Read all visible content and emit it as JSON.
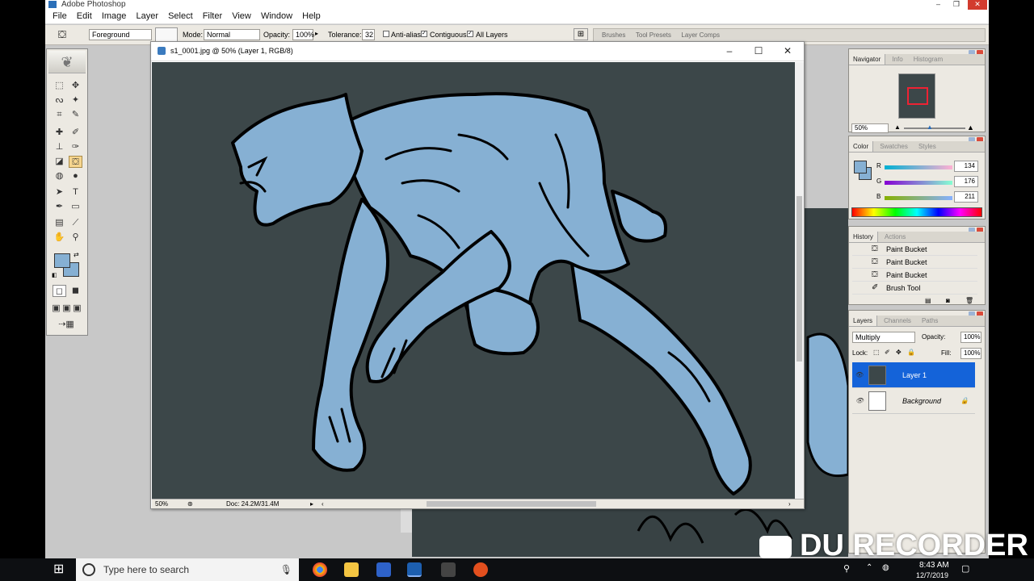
{
  "app": {
    "title": "Adobe Photoshop"
  },
  "menu": [
    "File",
    "Edit",
    "Image",
    "Layer",
    "Select",
    "Filter",
    "View",
    "Window",
    "Help"
  ],
  "options": {
    "fill_source": "Foreground",
    "mode_label": "Mode:",
    "mode_value": "Normal",
    "opacity_label": "Opacity:",
    "opacity_value": "100%",
    "tolerance_label": "Tolerance:",
    "tolerance_value": "32",
    "anti_alias": "Anti-alias",
    "contiguous": "Contiguous",
    "all_layers": "All Layers",
    "wells": [
      "Brushes",
      "Tool Presets",
      "Layer Comps"
    ]
  },
  "document": {
    "title": "s1_0001.jpg @ 50% (Layer 1, RGB/8)",
    "zoom": "50%",
    "doc_size": "Doc: 24.2M/31.4M"
  },
  "navigator": {
    "tabs": [
      "Navigator",
      "Info",
      "Histogram"
    ],
    "zoom": "50%"
  },
  "color": {
    "tabs": [
      "Color",
      "Swatches",
      "Styles"
    ],
    "r_label": "R",
    "g_label": "G",
    "b_label": "B",
    "r": "134",
    "g": "176",
    "b": "211",
    "fg_hex": "#86b0d3"
  },
  "history": {
    "tabs": [
      "History",
      "Actions"
    ],
    "items": [
      "Paint Bucket",
      "Paint Bucket",
      "Paint Bucket",
      "Brush Tool"
    ]
  },
  "layers": {
    "tabs": [
      "Layers",
      "Channels",
      "Paths"
    ],
    "blend_mode": "Multiply",
    "opacity_label": "Opacity:",
    "opacity_value": "100%",
    "lock_label": "Lock:",
    "fill_label": "Fill:",
    "fill_value": "100%",
    "items": [
      {
        "name": "Layer 1",
        "selected": true
      },
      {
        "name": "Background",
        "selected": false
      }
    ]
  },
  "taskbar": {
    "search_placeholder": "Type here to search",
    "time": "8:43 AM",
    "date": "12/7/2019"
  },
  "watermark": "DU RECORDER"
}
